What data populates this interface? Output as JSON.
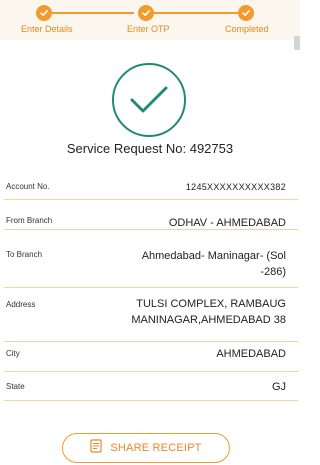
{
  "stepper": {
    "steps": [
      {
        "label": "Enter Details"
      },
      {
        "label": "Enter OTP"
      },
      {
        "label": "Completed"
      }
    ],
    "accent": "#f29a2e"
  },
  "success": {
    "icon": "checkmark-icon",
    "color": "#1f8a78",
    "title": "Service Request No: 492753"
  },
  "details": [
    {
      "key": "Account No.",
      "value": "1245XXXXXXXXXX382"
    },
    {
      "key": "From Branch",
      "value": "ODHAV - AHMEDABAD"
    },
    {
      "key": "To Branch",
      "value_lines": [
        "Ahmedabad- Maninagar- (Sol",
        "-286)"
      ]
    },
    {
      "key": "Address",
      "value_lines": [
        "TULSI COMPLEX, RAMBAUG",
        "MANINAGAR,AHMEDABAD 38"
      ]
    },
    {
      "key": "City",
      "value": "AHMEDABAD"
    },
    {
      "key": "State",
      "value": "GJ"
    }
  ],
  "share": {
    "label": "SHARE RECEIPT",
    "icon": "receipt-icon"
  }
}
